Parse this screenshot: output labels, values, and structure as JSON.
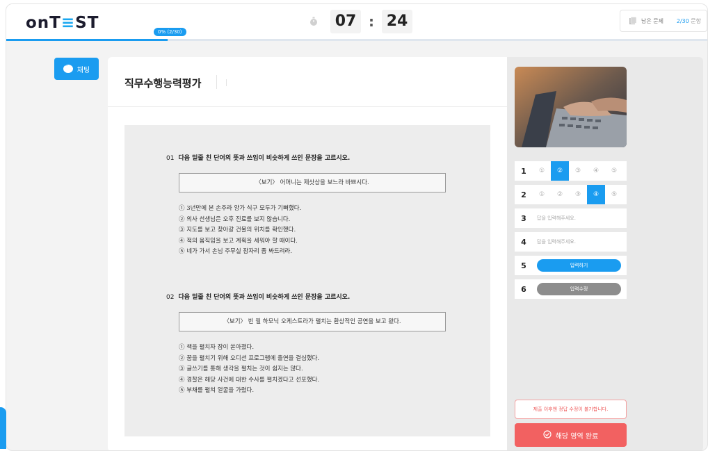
{
  "header": {
    "logo_prefix": "onT",
    "logo_mid": "Ξ",
    "logo_suffix": "ST",
    "progress_label": "0% (2/30)",
    "progress_fraction": 0.23,
    "timer_minutes": "07",
    "timer_seconds": "24",
    "timer_colon": ":",
    "remaining_label": "남은 문제",
    "remaining_count": "2/30",
    "remaining_unit": " 문항"
  },
  "chat": {
    "label": "채팅"
  },
  "main": {
    "title": "직무수행능력평가",
    "questions": [
      {
        "number": "01",
        "prompt": "다음 밑줄 친 단어의 뜻과 쓰임이 비슷하게 쓰인 문장을 고르시오.",
        "example": "〈보기〉 어머니는 제삿상을 보느라 바쁘시다.",
        "options": [
          "① 3년만에 본 손주라 양가 식구 모두가 기뻐했다.",
          "② 의사 선생님은 오후 진료를 보지 않습니다.",
          "③ 지도를 보고 찾아갈 건물의 위치를 확인했다.",
          "④ 적의 움직임을 보고 계획을 세워야 할 때이다.",
          "⑤ 네가 가서 손님 주무실 잠자리 좀 봐드려라."
        ]
      },
      {
        "number": "02",
        "prompt": "다음 밑줄 친 단어의 뜻과 쓰임이 비슷하게 쓰인 문장을 고르시오.",
        "example": "〈보기〉 빈 필 하모닉 오케스트라가 펼치는 환상적인 공연을 보고 왔다.",
        "options": [
          "① 책을 펼치자 잠이 쏟아졌다.",
          "② 꿈을 펼치기 위해 오디션 프로그램에 출연을 결심했다.",
          "③ 글쓰기를 통해 생각을 펼치는 것이 쉽지는 않다.",
          "④ 경찰은 해당 사건에 대한 수사를 펼치겠다고 선포했다.",
          "⑤ 부채를 펼쳐 얼굴을 가렸다."
        ]
      }
    ]
  },
  "answers": {
    "rows": [
      {
        "num": "1",
        "type": "choice",
        "options": [
          "①",
          "②",
          "③",
          "④",
          "⑤"
        ],
        "selected": 1
      },
      {
        "num": "2",
        "type": "choice",
        "options": [
          "①",
          "②",
          "③",
          "④",
          "⑤"
        ],
        "selected": 3
      },
      {
        "num": "3",
        "type": "text",
        "placeholder": "답을 입력해주세요."
      },
      {
        "num": "4",
        "type": "text",
        "placeholder": "답을 입력해주세요."
      },
      {
        "num": "5",
        "type": "button",
        "label": "입력하기",
        "style": "blue"
      },
      {
        "num": "6",
        "type": "button",
        "label": "입력수정",
        "style": "gray"
      }
    ],
    "notice": "제출 이후엔 정답 수정이 불가합니다.",
    "complete_label": "해당 영역 완료"
  },
  "colors": {
    "accent": "#1a9cf0",
    "danger": "#f26161"
  },
  "icons": {
    "timer": "stopwatch-icon",
    "remaining": "document-icon",
    "chat": "chat-bubble-icon",
    "complete": "check-circle-icon"
  }
}
